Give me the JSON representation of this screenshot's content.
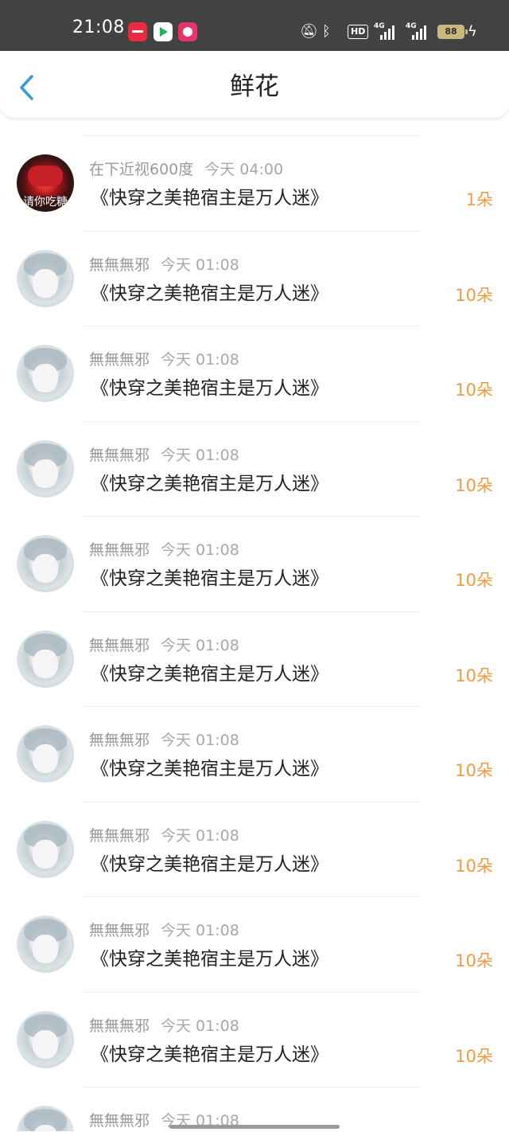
{
  "status_bar": {
    "time": "21:08",
    "apps": [
      "xiaohongshu-icon",
      "video-app-icon",
      "chat-app-icon"
    ],
    "hd_label": "HD",
    "network1": "4G",
    "network2": "4G",
    "battery": "88"
  },
  "header": {
    "title": "鲜花",
    "back_icon": "chevron-left-icon"
  },
  "colors": {
    "accent": "#3a9bd9",
    "count": "#f09a41",
    "meta": "#9a9a9a"
  },
  "list": [
    {
      "user": "在下近视600度",
      "time": "今天 04:00",
      "book": "《快穿之美艳宿主是万人迷》",
      "count": "1朵",
      "avatar_caption": "请你吃糖"
    },
    {
      "user": "無無無邪",
      "time": "今天 01:08",
      "book": "《快穿之美艳宿主是万人迷》",
      "count": "10朵"
    },
    {
      "user": "無無無邪",
      "time": "今天 01:08",
      "book": "《快穿之美艳宿主是万人迷》",
      "count": "10朵"
    },
    {
      "user": "無無無邪",
      "time": "今天 01:08",
      "book": "《快穿之美艳宿主是万人迷》",
      "count": "10朵"
    },
    {
      "user": "無無無邪",
      "time": "今天 01:08",
      "book": "《快穿之美艳宿主是万人迷》",
      "count": "10朵"
    },
    {
      "user": "無無無邪",
      "time": "今天 01:08",
      "book": "《快穿之美艳宿主是万人迷》",
      "count": "10朵"
    },
    {
      "user": "無無無邪",
      "time": "今天 01:08",
      "book": "《快穿之美艳宿主是万人迷》",
      "count": "10朵"
    },
    {
      "user": "無無無邪",
      "time": "今天 01:08",
      "book": "《快穿之美艳宿主是万人迷》",
      "count": "10朵"
    },
    {
      "user": "無無無邪",
      "time": "今天 01:08",
      "book": "《快穿之美艳宿主是万人迷》",
      "count": "10朵"
    },
    {
      "user": "無無無邪",
      "time": "今天 01:08",
      "book": "《快穿之美艳宿主是万人迷》",
      "count": "10朵"
    },
    {
      "user": "無無無邪",
      "time": "今天 01:08"
    }
  ]
}
